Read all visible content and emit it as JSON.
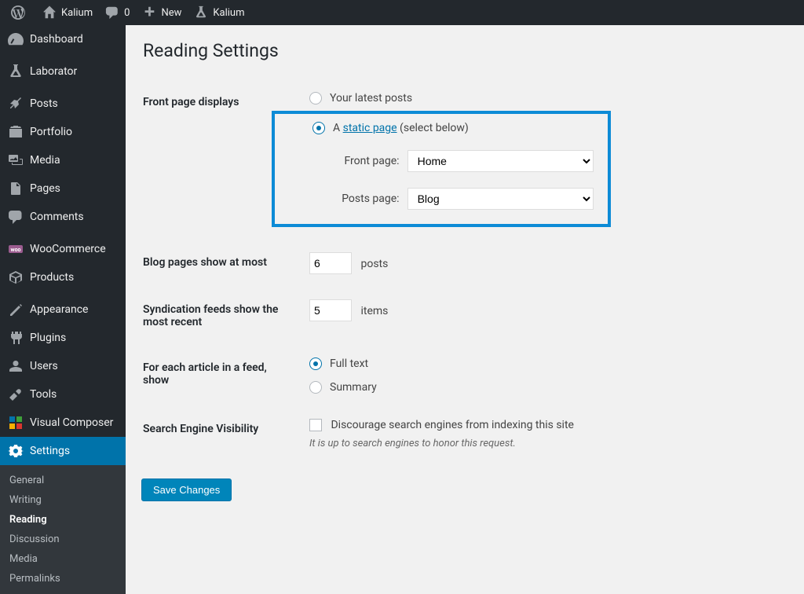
{
  "adminbar": {
    "site_name": "Kalium",
    "comments_count": "0",
    "new_label": "New",
    "lab_label": "Kalium"
  },
  "sidebar": {
    "items": [
      {
        "label": "Dashboard"
      },
      {
        "label": "Laborator"
      },
      {
        "label": "Posts"
      },
      {
        "label": "Portfolio"
      },
      {
        "label": "Media"
      },
      {
        "label": "Pages"
      },
      {
        "label": "Comments"
      },
      {
        "label": "WooCommerce"
      },
      {
        "label": "Products"
      },
      {
        "label": "Appearance"
      },
      {
        "label": "Plugins"
      },
      {
        "label": "Users"
      },
      {
        "label": "Tools"
      },
      {
        "label": "Visual Composer"
      },
      {
        "label": "Settings"
      }
    ],
    "submenu": [
      {
        "label": "General"
      },
      {
        "label": "Writing"
      },
      {
        "label": "Reading"
      },
      {
        "label": "Discussion"
      },
      {
        "label": "Media"
      },
      {
        "label": "Permalinks"
      }
    ]
  },
  "page": {
    "title": "Reading Settings",
    "front_page_displays_label": "Front page displays",
    "opt_latest_posts": "Your latest posts",
    "opt_static_prefix": "A ",
    "opt_static_link": "static page",
    "opt_static_suffix": " (select below)",
    "front_page_label": "Front page:",
    "front_page_value": "Home",
    "posts_page_label": "Posts page:",
    "posts_page_value": "Blog",
    "blog_pages_label": "Blog pages show at most",
    "blog_pages_value": "6",
    "blog_pages_unit": "posts",
    "syndication_label": "Syndication feeds show the most recent",
    "syndication_value": "5",
    "syndication_unit": "items",
    "feed_show_label": "For each article in a feed, show",
    "feed_full_text": "Full text",
    "feed_summary": "Summary",
    "sev_label": "Search Engine Visibility",
    "sev_checkbox_label": "Discourage search engines from indexing this site",
    "sev_desc": "It is up to search engines to honor this request.",
    "save_label": "Save Changes"
  }
}
